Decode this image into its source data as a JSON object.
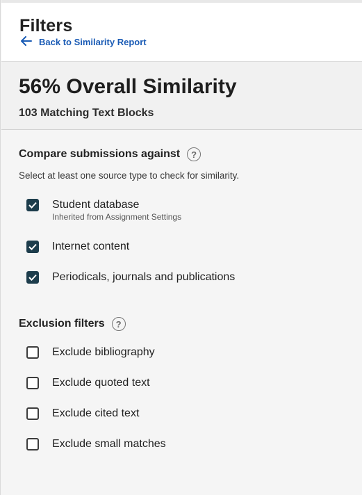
{
  "header": {
    "title": "Filters",
    "back_label": "Back to Similarity Report"
  },
  "summary": {
    "similarity": "56% Overall Similarity",
    "matches": "103 Matching Text Blocks"
  },
  "compare": {
    "heading": "Compare submissions against",
    "help": "?",
    "hint": "Select at least one source type to check for similarity.",
    "options": [
      {
        "label": "Student database",
        "note": "Inherited from Assignment Settings",
        "checked": true
      },
      {
        "label": "Internet content",
        "checked": true
      },
      {
        "label": "Periodicals, journals and publications",
        "checked": true
      }
    ]
  },
  "exclusions": {
    "heading": "Exclusion filters",
    "help": "?",
    "options": [
      {
        "label": "Exclude bibliography",
        "checked": false
      },
      {
        "label": "Exclude quoted text",
        "checked": false
      },
      {
        "label": "Exclude cited text",
        "checked": false
      },
      {
        "label": "Exclude small matches",
        "checked": false
      }
    ]
  },
  "colors": {
    "checkbox_checked": "#1d3d4c",
    "link": "#1a5bb5"
  },
  "icons": {
    "back": "arrow-left-icon",
    "help": "question-circle-icon",
    "check": "checkmark-icon"
  }
}
